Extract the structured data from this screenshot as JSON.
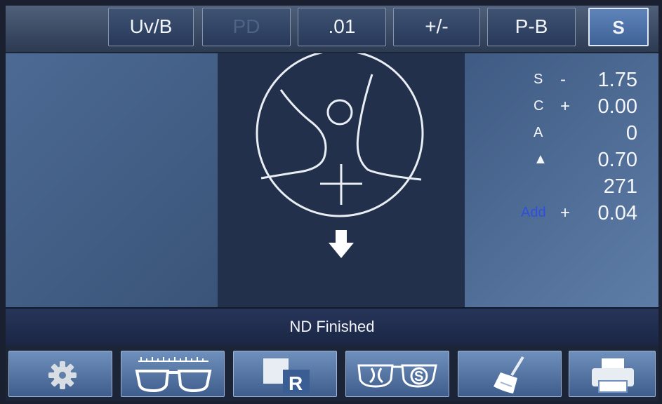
{
  "toolbar": {
    "buttons": [
      {
        "label": "Uv/B",
        "state": "normal"
      },
      {
        "label": "PD",
        "state": "disabled"
      },
      {
        "label": ".01",
        "state": "normal"
      },
      {
        "label": "+/-",
        "state": "normal"
      },
      {
        "label": "P-B",
        "state": "normal"
      },
      {
        "label": "S",
        "state": "active"
      }
    ]
  },
  "measurements": [
    {
      "label": "S",
      "sign": "-",
      "value": "1.75"
    },
    {
      "label": "C",
      "sign": "+",
      "value": "0.00"
    },
    {
      "label": "A",
      "sign": "",
      "value": "0"
    },
    {
      "label": "▲",
      "sign": "",
      "value": "0.70"
    },
    {
      "label": "",
      "sign": "",
      "value": "271"
    },
    {
      "label": "Add",
      "sign": "+",
      "value": "0.04"
    }
  ],
  "status": {
    "message": "ND Finished"
  },
  "bottom_buttons": [
    {
      "icon": "gear-icon"
    },
    {
      "icon": "glasses-ruler-icon"
    },
    {
      "icon": "lens-r-icon",
      "label": "R"
    },
    {
      "icon": "glasses-s-icon",
      "label": "S"
    },
    {
      "icon": "brush-icon"
    },
    {
      "icon": "printer-icon"
    }
  ],
  "colors": {
    "panel": "#2b3b58",
    "active_button": "#4f74aa",
    "add_label": "#2f4fe0",
    "text": "#f4f6fa"
  }
}
